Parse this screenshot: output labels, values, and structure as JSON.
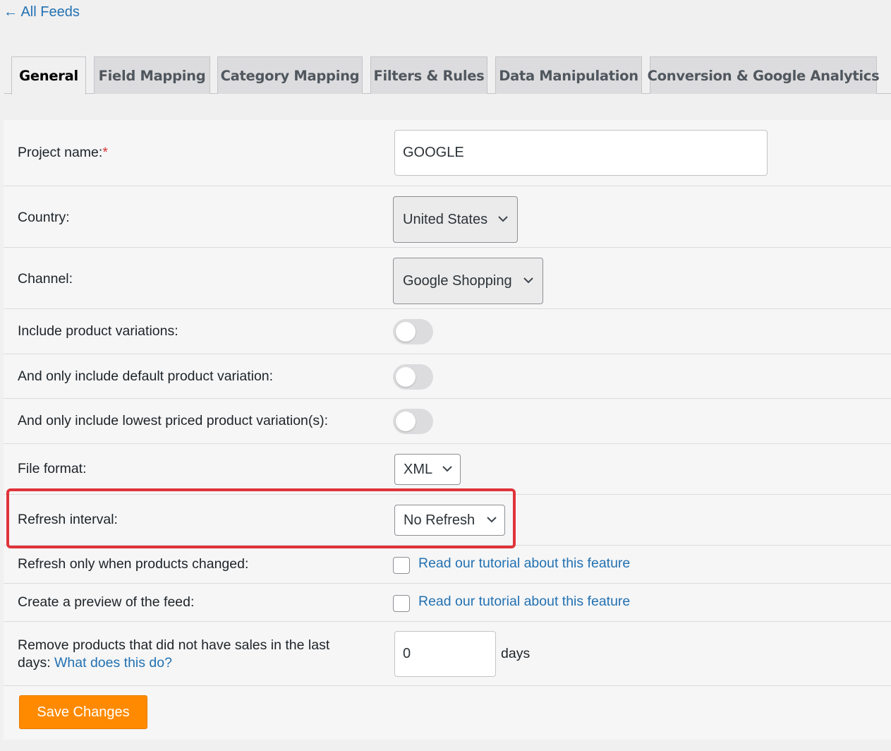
{
  "nav": {
    "back_link": "← All Feeds"
  },
  "tabs": [
    {
      "label": "General",
      "active": true
    },
    {
      "label": "Field Mapping",
      "active": false
    },
    {
      "label": "Category Mapping",
      "active": false
    },
    {
      "label": "Filters & Rules",
      "active": false
    },
    {
      "label": "Data Manipulation",
      "active": false
    },
    {
      "label": "Conversion & Google Analytics",
      "active": false
    }
  ],
  "form": {
    "project_name": {
      "label": "Project name:",
      "required_mark": "*",
      "value": "GOOGLE"
    },
    "country": {
      "label": "Country:",
      "value": "United States"
    },
    "channel": {
      "label": "Channel:",
      "value": "Google Shopping"
    },
    "include_variations": {
      "label": "Include product variations:",
      "enabled": false
    },
    "default_variation": {
      "label": "And only include default product variation:",
      "enabled": false
    },
    "lowest_priced": {
      "label": "And only include lowest priced product variation(s):",
      "enabled": false
    },
    "file_format": {
      "label": "File format:",
      "value": "XML"
    },
    "refresh_interval": {
      "label": "Refresh interval:",
      "value": "No Refresh"
    },
    "refresh_on_change": {
      "label": "Refresh only when products changed:",
      "checked": false,
      "link": "Read our tutorial about this feature"
    },
    "preview": {
      "label": "Create a preview of the feed:",
      "checked": false,
      "link": "Read our tutorial about this feature"
    },
    "remove_no_sales": {
      "label_line1": "Remove products that did not have sales in the last",
      "label_line2": "days:",
      "help_link": "What does this do?",
      "value": "0",
      "unit": "days"
    },
    "save_button": "Save Changes"
  },
  "colors": {
    "link": "#2271b1",
    "save_button": "#ff8a00",
    "highlight_border": "#e0333a",
    "required": "#d63638"
  }
}
